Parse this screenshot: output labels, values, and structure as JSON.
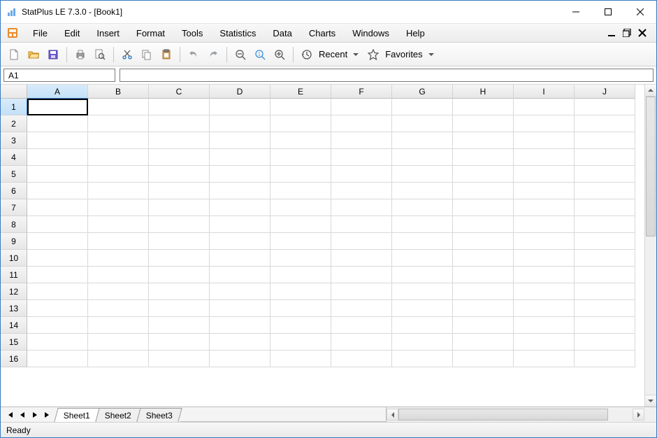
{
  "window": {
    "title": "StatPlus LE 7.3.0  - [Book1]"
  },
  "menu": {
    "items": [
      "File",
      "Edit",
      "Insert",
      "Format",
      "Tools",
      "Statistics",
      "Data",
      "Charts",
      "Windows",
      "Help"
    ]
  },
  "toolbar": {
    "recent_label": "Recent",
    "favorites_label": "Favorites"
  },
  "namebox": {
    "value": "A1"
  },
  "formula": {
    "value": ""
  },
  "grid": {
    "columns": [
      "A",
      "B",
      "C",
      "D",
      "E",
      "F",
      "G",
      "H",
      "I",
      "J"
    ],
    "rows": [
      "1",
      "2",
      "3",
      "4",
      "5",
      "6",
      "7",
      "8",
      "9",
      "10",
      "11",
      "12",
      "13",
      "14",
      "15",
      "16"
    ],
    "selected_col": "A",
    "selected_row": "1"
  },
  "sheets": {
    "tabs": [
      "Sheet1",
      "Sheet2",
      "Sheet3"
    ],
    "active": "Sheet1"
  },
  "status": {
    "text": "Ready"
  }
}
